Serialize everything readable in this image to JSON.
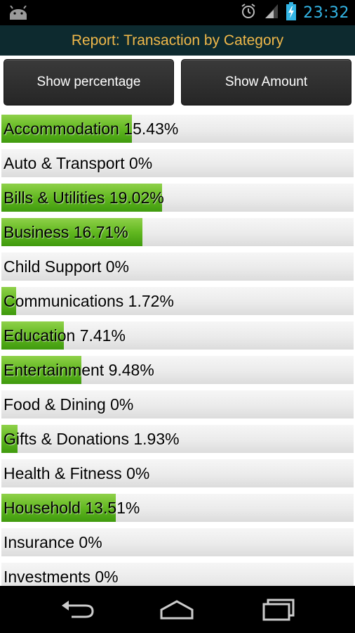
{
  "status_bar": {
    "time": "23:32",
    "icons": [
      "android-icon",
      "alarm-icon",
      "signal-icon",
      "battery-charging-icon"
    ],
    "accent_color": "#33b5e5"
  },
  "title_bar": {
    "title": "Report: Transaction by Category",
    "title_color": "#f0b84a"
  },
  "buttons": {
    "show_percentage": "Show percentage",
    "show_amount": "Show Amount"
  },
  "categories": [
    {
      "label": "Accommodation 15.43%",
      "percent": 15.43
    },
    {
      "label": "Auto & Transport 0%",
      "percent": 0
    },
    {
      "label": "Bills & Utilities 19.02%",
      "percent": 19.02
    },
    {
      "label": "Business 16.71%",
      "percent": 16.71
    },
    {
      "label": "Child Support 0%",
      "percent": 0
    },
    {
      "label": "Communications 1.72%",
      "percent": 1.72
    },
    {
      "label": "Education 7.41%",
      "percent": 7.41
    },
    {
      "label": "Entertainment 9.48%",
      "percent": 9.48
    },
    {
      "label": "Food & Dining 0%",
      "percent": 0
    },
    {
      "label": "Gifts & Donations 1.93%",
      "percent": 1.93
    },
    {
      "label": "Health & Fitness 0%",
      "percent": 0
    },
    {
      "label": "Household 13.51%",
      "percent": 13.51
    },
    {
      "label": "Insurance 0%",
      "percent": 0
    },
    {
      "label": "Investments 0%",
      "percent": 0
    }
  ],
  "bar_color": "#62b820",
  "nav_bar": {
    "icons": [
      "back-icon",
      "home-icon",
      "recent-apps-icon"
    ]
  }
}
